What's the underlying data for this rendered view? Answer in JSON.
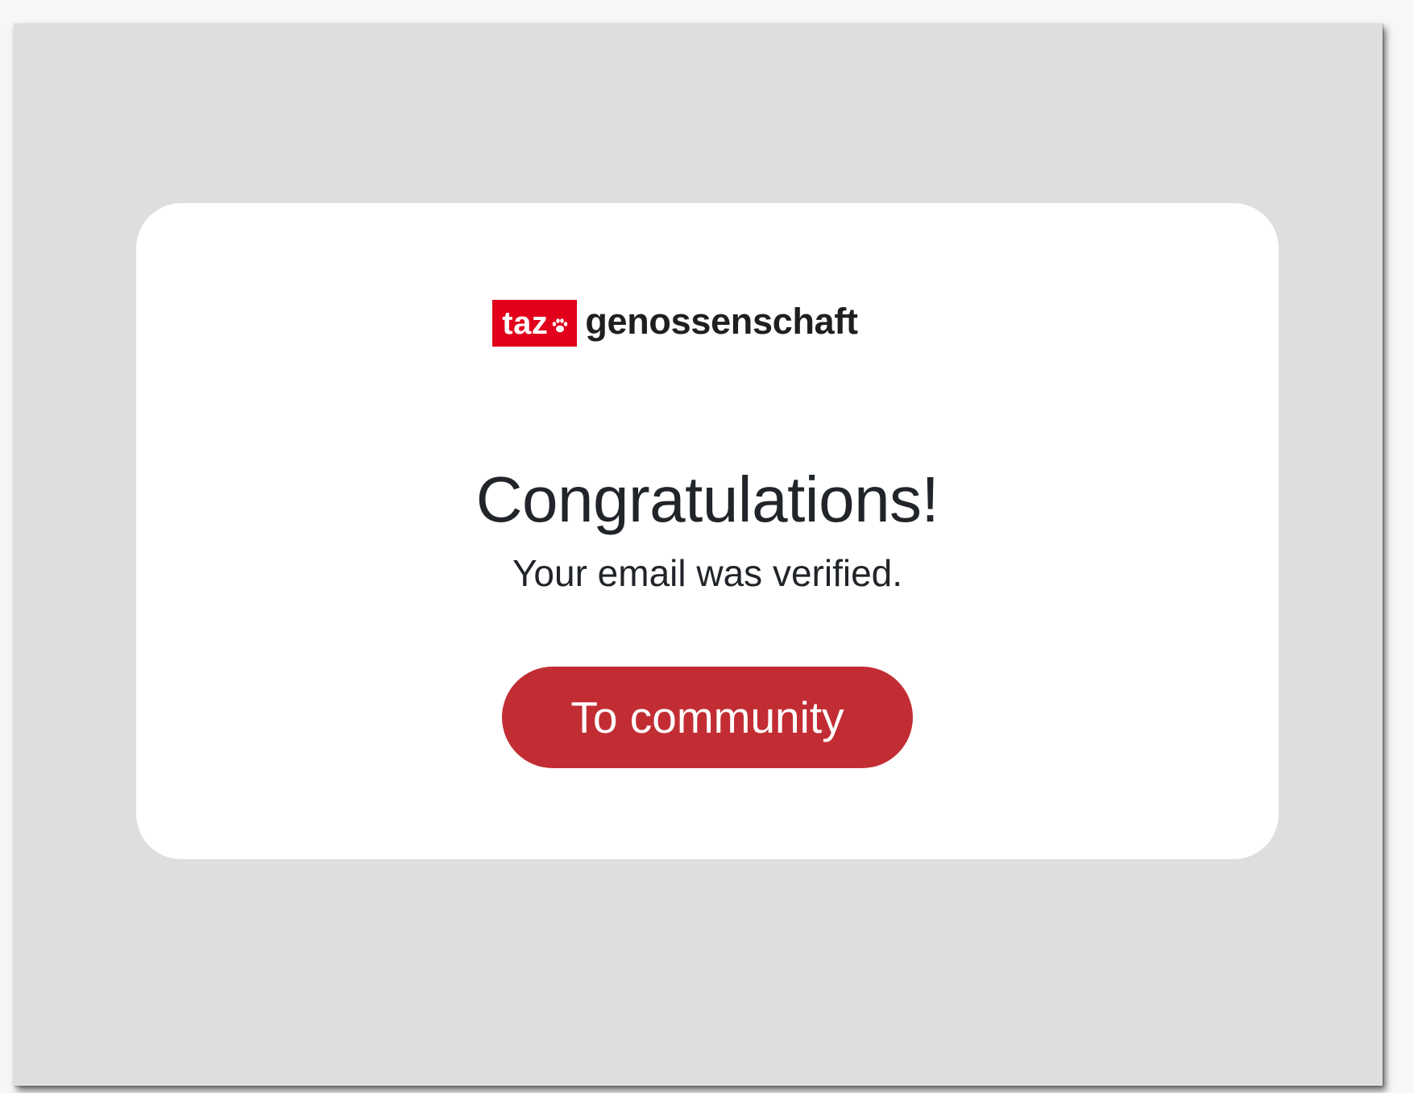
{
  "logo": {
    "badge_text": "taz",
    "word": "genossenschaft",
    "badge_color": "#e2001a",
    "icon": "paw-icon"
  },
  "message": {
    "title": "Congratulations!",
    "subtitle": "Your email was verified."
  },
  "actions": {
    "primary_label": "To community",
    "primary_color": "#c22d33"
  },
  "colors": {
    "background": "#dedede",
    "card": "#ffffff",
    "text": "#212529"
  }
}
